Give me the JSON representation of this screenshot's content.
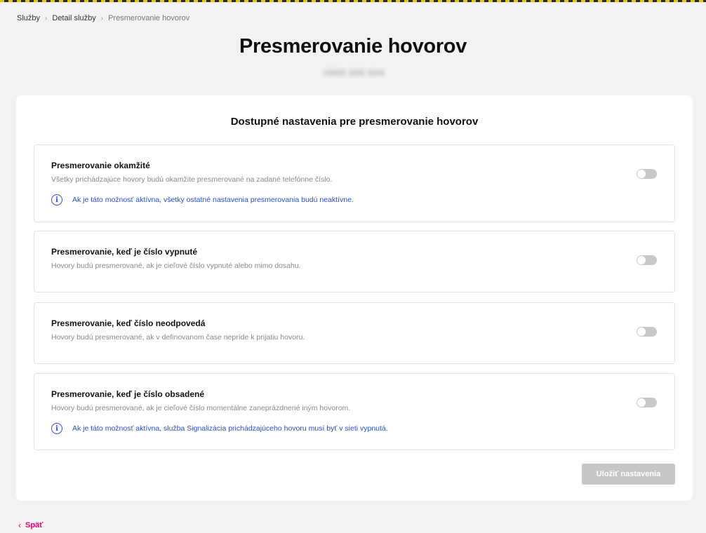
{
  "breadcrumb": {
    "items": [
      "Služby",
      "Detail služby",
      "Presmerovanie hovorov"
    ]
  },
  "page": {
    "title": "Presmerovanie hovorov",
    "phone_number": "0900 000 004"
  },
  "panel": {
    "title": "Dostupné nastavenia pre presmerovanie hovorov",
    "options": [
      {
        "title": "Presmerovanie okamžité",
        "description": "Všetky prichádzajúce hovory budú okamžite presmerované na zadané telefónne číslo.",
        "info": "Ak je táto možnosť aktívna, všetky ostatné nastavenia presmerovania budú neaktívne.",
        "enabled": false
      },
      {
        "title": "Presmerovanie, keď je číslo vypnuté",
        "description": "Hovory budú presmerované, ak je cieľové číslo vypnuté alebo mimo dosahu.",
        "enabled": false
      },
      {
        "title": "Presmerovanie, keď číslo neodpovedá",
        "description": "Hovory budú presmerované, ak v definovanom čase nepríde k prijatiu hovoru.",
        "enabled": false
      },
      {
        "title": "Presmerovanie, keď je číslo obsadené",
        "description": "Hovory budú presmerované, ak je cieľové číslo momentálne zaneprázdnené iným hovorom.",
        "info": "Ak je táto možnosť aktívna, služba Signalizácia prichádzajúceho hovoru musí byť v sieti vypnutá.",
        "enabled": false
      }
    ],
    "save_label": "Uložiť nastavenia"
  },
  "footer": {
    "back_label": "Späť"
  },
  "colors": {
    "accent": "#e20074",
    "info": "#2a4fcf",
    "toggle_off": "#c9c9c9",
    "button_disabled": "#c6c6c6"
  },
  "icons": {
    "info": "info-circle-icon",
    "back": "chevron-left-icon",
    "breadcrumb_sep": "chevron-right-icon"
  }
}
